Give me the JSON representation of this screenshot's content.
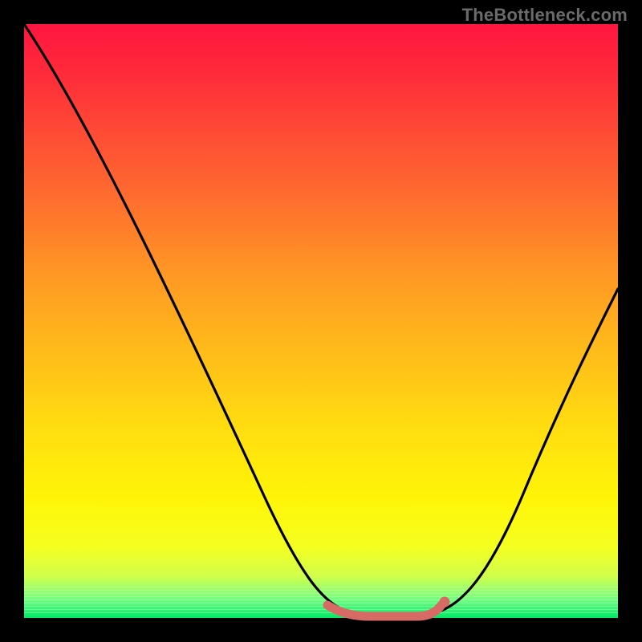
{
  "watermark": "TheBottleneck.com",
  "colors": {
    "frame": "#000000",
    "curve_stroke": "#000000",
    "trough_stroke": "#d86a66",
    "gradient_top": "#ff153f",
    "gradient_bottom": "#00e865"
  },
  "chart_data": {
    "type": "line",
    "title": "",
    "xlabel": "",
    "ylabel": "",
    "xlim": [
      0,
      100
    ],
    "ylim": [
      0,
      100
    ],
    "x": [
      0,
      5,
      10,
      15,
      20,
      25,
      30,
      35,
      40,
      45,
      50,
      52,
      55,
      58,
      62,
      65,
      68,
      72,
      76,
      80,
      84,
      88,
      92,
      96,
      100
    ],
    "values": [
      100,
      92,
      83,
      74,
      65,
      56,
      47,
      38,
      29,
      20,
      11,
      6,
      2,
      0,
      0,
      0,
      2,
      6,
      12,
      19,
      27,
      35,
      43,
      50,
      56
    ],
    "trough_region_x": [
      52,
      68
    ],
    "annotations": []
  }
}
